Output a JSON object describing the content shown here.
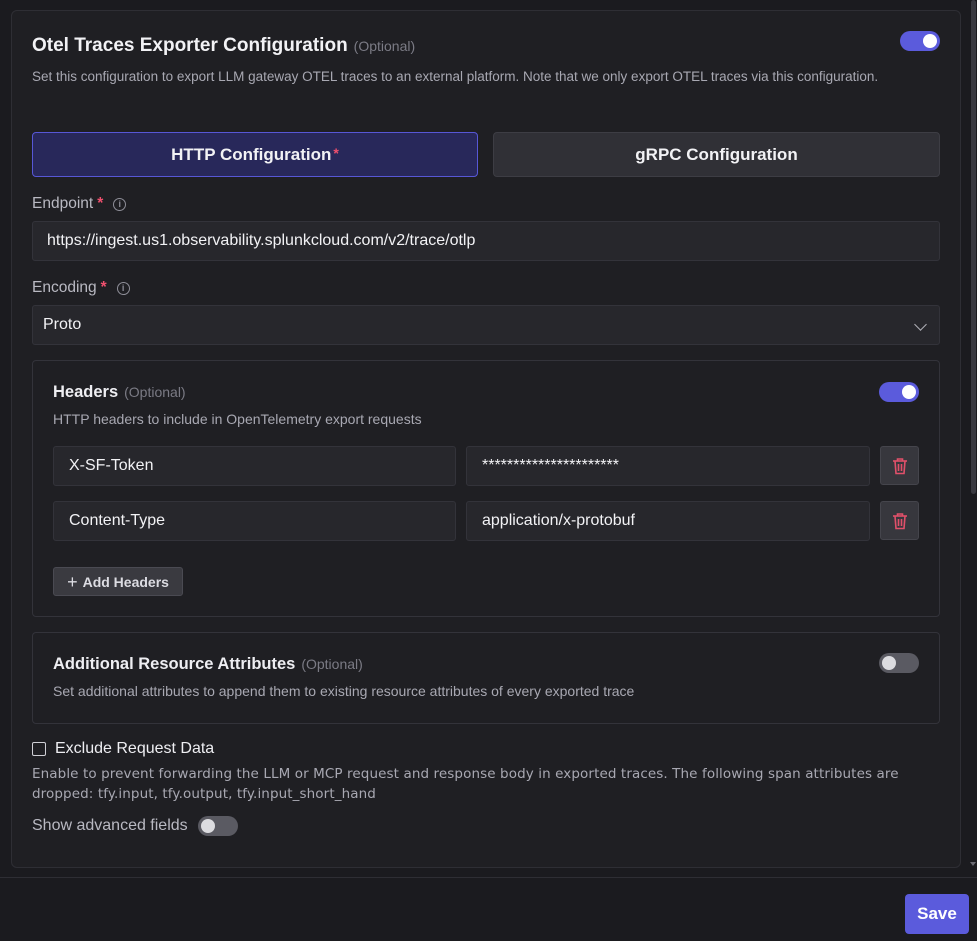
{
  "otel": {
    "title": "Otel Traces Exporter Configuration",
    "optional": "(Optional)",
    "description": "Set this configuration to export LLM gateway OTEL traces to an external platform. Note that we only export OTEL traces via this configuration.",
    "enabled": true
  },
  "tabs": {
    "http": {
      "label": "HTTP Configuration",
      "required": "*",
      "selected": true
    },
    "grpc": {
      "label": "gRPC Configuration",
      "selected": false
    }
  },
  "endpoint": {
    "label": "Endpoint",
    "required": "*",
    "info_icon": "info-icon",
    "value": "https://ingest.us1.observability.splunkcloud.com/v2/trace/otlp"
  },
  "encoding": {
    "label": "Encoding",
    "required": "*",
    "info_icon": "info-icon",
    "value": "Proto",
    "dropdown_icon": "chevron-down-icon"
  },
  "headers": {
    "title": "Headers",
    "optional": "(Optional)",
    "description": "HTTP headers to include in OpenTelemetry export requests",
    "enabled": true,
    "rows": [
      {
        "key": "X-SF-Token",
        "value": "**********************",
        "delete_icon": "trash-icon"
      },
      {
        "key": "Content-Type",
        "value": "application/x-protobuf",
        "delete_icon": "trash-icon"
      }
    ],
    "add_label": "Add Headers",
    "add_icon": "plus-icon"
  },
  "resource_attributes": {
    "title": "Additional Resource Attributes",
    "optional": "(Optional)",
    "description": "Set additional attributes to append them to existing resource attributes of every exported trace",
    "enabled": false
  },
  "exclude_request": {
    "label": "Exclude Request Data",
    "checked": false,
    "description": "Enable to prevent forwarding the LLM or MCP request and response body in exported traces. The following span attributes are dropped: tfy.input, tfy.output, tfy.input_short_hand"
  },
  "advanced": {
    "label": "Show advanced fields",
    "enabled": false
  },
  "footer": {
    "save_label": "Save"
  },
  "colors": {
    "accent": "#5b5bdc",
    "required": "#f0506e",
    "delete": "#e0506a",
    "background": "#1b1b1f"
  }
}
